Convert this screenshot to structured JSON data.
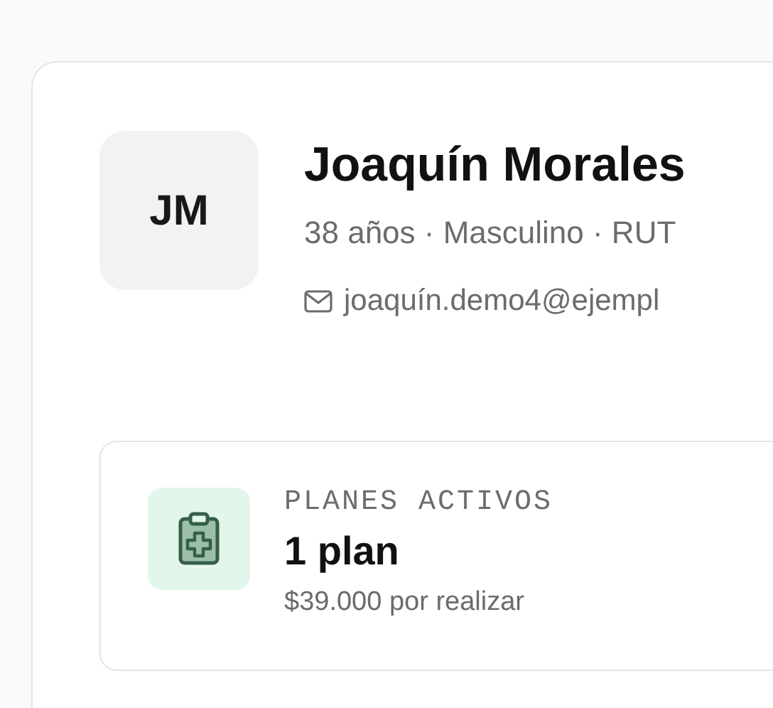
{
  "patient": {
    "initials": "JM",
    "name": "Joaquín Morales",
    "meta": "38 años · Masculino · RUT",
    "email": "joaquín.demo4@ejempl"
  },
  "stat": {
    "label": "PLANES ACTIVOS",
    "value": "1 plan",
    "detail": "$39.000 por realizar"
  }
}
